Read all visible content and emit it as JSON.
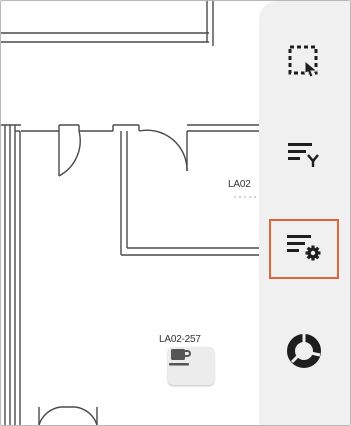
{
  "map": {
    "rooms": [
      {
        "label": "LA02"
      },
      {
        "label": "LA02-257"
      }
    ],
    "poi": {
      "icon": "coffee-cup-icon"
    }
  },
  "toolbar": {
    "tools": [
      {
        "icon": "select-area-icon",
        "active": false
      },
      {
        "icon": "filter-list-icon",
        "active": false
      },
      {
        "icon": "list-settings-icon",
        "active": true
      },
      {
        "icon": "donut-chart-icon",
        "active": false
      }
    ],
    "colors": {
      "active_outline": "#e0653a",
      "icon": "#1e1e1e",
      "background": "#f0f0f0"
    }
  }
}
